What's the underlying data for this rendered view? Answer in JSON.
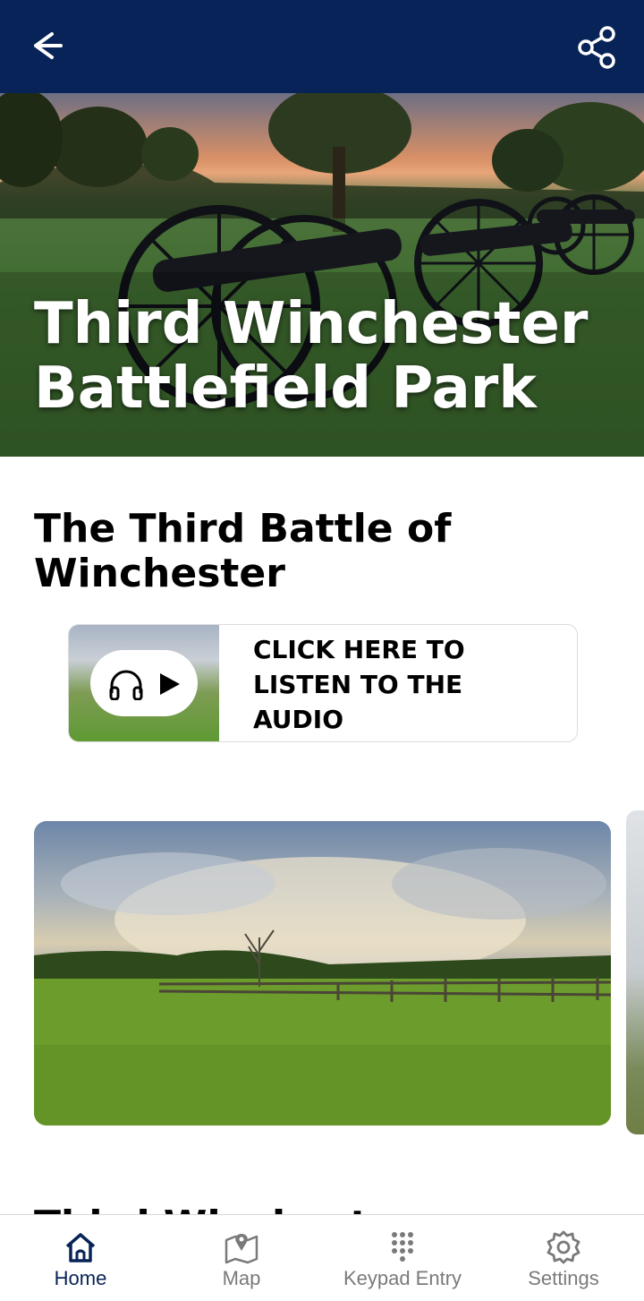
{
  "app_bar": {
    "back_icon": "arrow-left-icon",
    "share_icon": "share-icon",
    "background": "#082358"
  },
  "hero": {
    "title": "Third Winchester Battlefield Park"
  },
  "section": {
    "title": "The Third Battle of Winchester"
  },
  "audio": {
    "label": "CLICK HERE TO LISTEN TO THE AUDIO",
    "icons": [
      "headphones-icon",
      "play-icon"
    ]
  },
  "next_section": {
    "title": "Third Winchester Battlefield"
  },
  "bottom_nav": {
    "items": [
      {
        "label": "Home",
        "icon": "home-icon",
        "active": true
      },
      {
        "label": "Map",
        "icon": "map-icon",
        "active": false
      },
      {
        "label": "Keypad Entry",
        "icon": "keypad-icon",
        "active": false
      },
      {
        "label": "Settings",
        "icon": "gear-icon",
        "active": false
      }
    ],
    "active_color": "#082358",
    "inactive_color": "#7a7a7a"
  }
}
